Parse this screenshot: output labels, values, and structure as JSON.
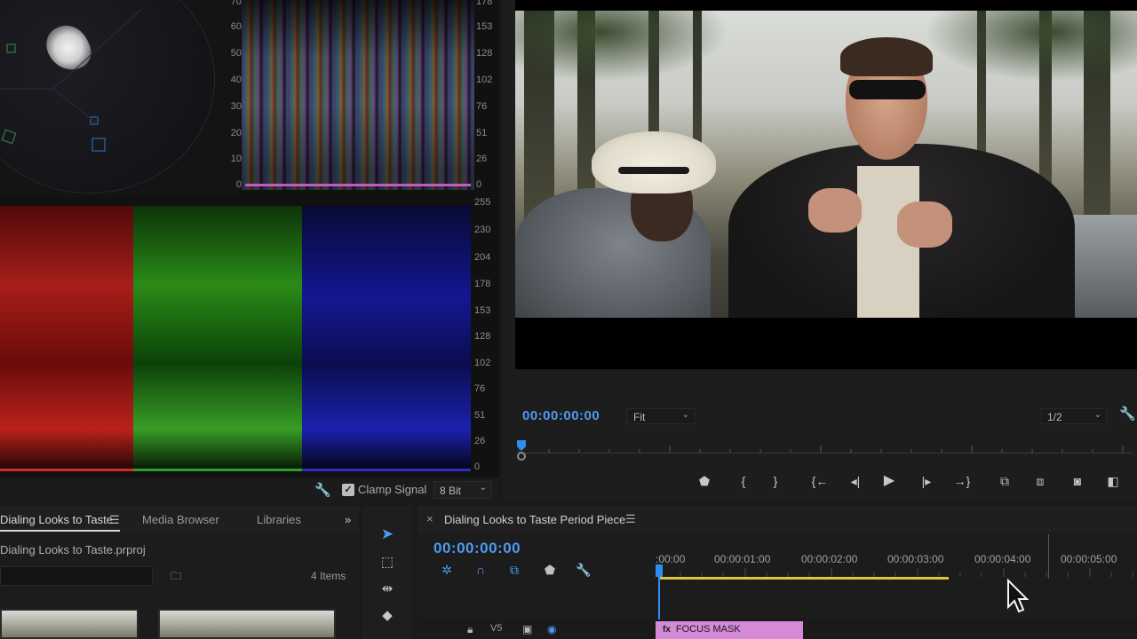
{
  "scopes": {
    "luma_scale_left": [
      "70",
      "60",
      "50",
      "40",
      "30",
      "20",
      "10",
      "0"
    ],
    "luma_scale_right": [
      "178",
      "153",
      "128",
      "102",
      "76",
      "51",
      "26",
      "0"
    ],
    "parade_scale": [
      "255",
      "230",
      "204",
      "178",
      "153",
      "128",
      "102",
      "76",
      "51",
      "26",
      "0"
    ],
    "footer": {
      "clamp_label": "Clamp Signal",
      "clamp_checked": true,
      "bit_depth": "8 Bit"
    }
  },
  "program_monitor": {
    "timecode": "00:00:00:00",
    "zoom": "Fit",
    "resolution": "1/2"
  },
  "project_panel": {
    "tabs": [
      {
        "label": "Dialing Looks to Taste",
        "active": true
      },
      {
        "label": "Media Browser",
        "active": false
      },
      {
        "label": "Libraries",
        "active": false
      }
    ],
    "overflow": "»",
    "file_name": "Dialing Looks to Taste.prproj",
    "item_count": "4 Items"
  },
  "timeline": {
    "title": "Dialing Looks to Taste Period Piece",
    "timecode": "00:00:00:00",
    "ruler": [
      ":00:00",
      "00:00:01:00",
      "00:00:02:00",
      "00:00:03:00",
      "00:00:04:00",
      "00:00:05:00"
    ],
    "clip_label": "FOCUS MASK",
    "track_label": "V5",
    "colors": {
      "accent": "#4c9bf0",
      "clip": "#d48ad6",
      "work_area": "#d8c83a"
    }
  },
  "icons": {
    "wrench": "wrench-icon",
    "marker": "marker-icon",
    "play": "play-icon"
  }
}
